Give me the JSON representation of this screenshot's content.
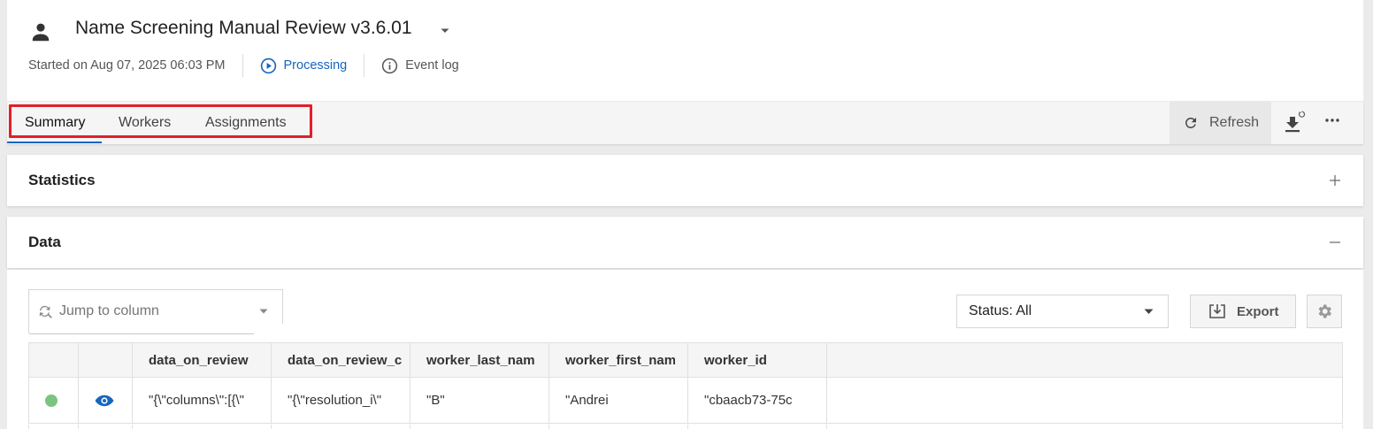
{
  "header": {
    "title": "Name Screening Manual Review v3.6.01",
    "started": "Started on Aug 07, 2025 06:03 PM",
    "status": "Processing",
    "event_log": "Event log",
    "icons": {
      "user": "person-icon",
      "caret": "caret-down-icon",
      "status": "play-circle-icon",
      "event_log": "info-icon"
    }
  },
  "tabs": [
    {
      "label": "Summary",
      "active": true
    },
    {
      "label": "Workers",
      "active": false
    },
    {
      "label": "Assignments",
      "active": false
    }
  ],
  "toolbar": {
    "refresh": "Refresh",
    "icons": {
      "refresh": "refresh-icon",
      "download": "download-sync-icon",
      "more": "more-horizontal-icon"
    }
  },
  "panels": {
    "statistics": {
      "title": "Statistics",
      "expanded": false
    },
    "data": {
      "title": "Data",
      "expanded": true
    }
  },
  "data": {
    "jump_placeholder": "Jump to column",
    "status_filter": "Status: All",
    "export": "Export",
    "columns": [
      "",
      "",
      "data_on_review",
      "data_on_review_c",
      "worker_last_name",
      "worker_first_nam",
      "worker_id",
      ""
    ],
    "rows": [
      {
        "status_color": "#7ac47f",
        "view_icon": "eye-icon",
        "data_on_review": "\"{\\\"columns\\\":[{\\\"",
        "data_on_review_c": "\"{\\\"resolution_i\\\"",
        "worker_last_name": "\"B\"",
        "worker_first_name": "\"Andrei",
        "worker_id": "\"cbaacb73-75c"
      }
    ]
  },
  "colors": {
    "accent": "#1565c0",
    "highlight_border": "#e0202a",
    "status_ok": "#7ac47f"
  }
}
